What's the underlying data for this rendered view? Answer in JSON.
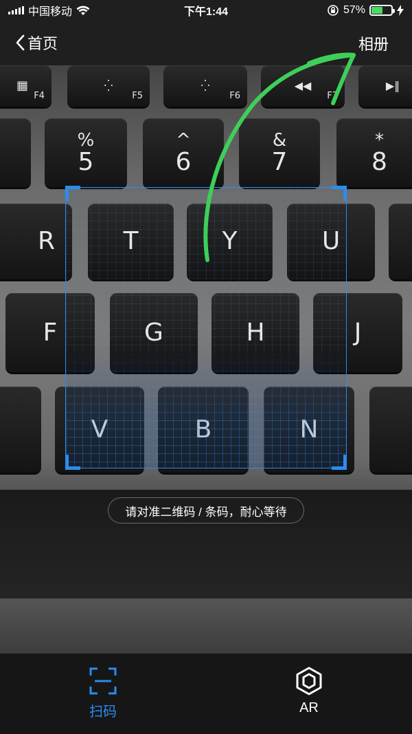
{
  "status_bar": {
    "carrier": "中国移动",
    "time": "下午1:44",
    "battery_percent": "57%",
    "battery_level": 0.57
  },
  "nav": {
    "back_label": "首页",
    "album_label": "相册"
  },
  "keyboard": {
    "fn_keys": [
      "F4",
      "F5",
      "F6",
      "F7"
    ],
    "number_row": [
      {
        "top": "%",
        "bottom": "5"
      },
      {
        "top": "^",
        "bottom": "6"
      },
      {
        "top": "&",
        "bottom": "7"
      },
      {
        "top": "*",
        "bottom": "8"
      }
    ],
    "row_r": [
      "R",
      "T",
      "Y",
      "U"
    ],
    "row_f": [
      "F",
      "G",
      "H",
      "J"
    ],
    "row_v": [
      "V",
      "B",
      "N"
    ]
  },
  "scan": {
    "hint": "请对准二维码 / 条码，耐心等待"
  },
  "tabs": [
    {
      "label": "扫码",
      "icon": "scan-icon",
      "active": true
    },
    {
      "label": "AR",
      "icon": "ar-cube-icon",
      "active": false
    }
  ],
  "colors": {
    "accent": "#2a8cf0",
    "battery": "#4cd964",
    "annotation_arrow": "#3ecf5a"
  }
}
